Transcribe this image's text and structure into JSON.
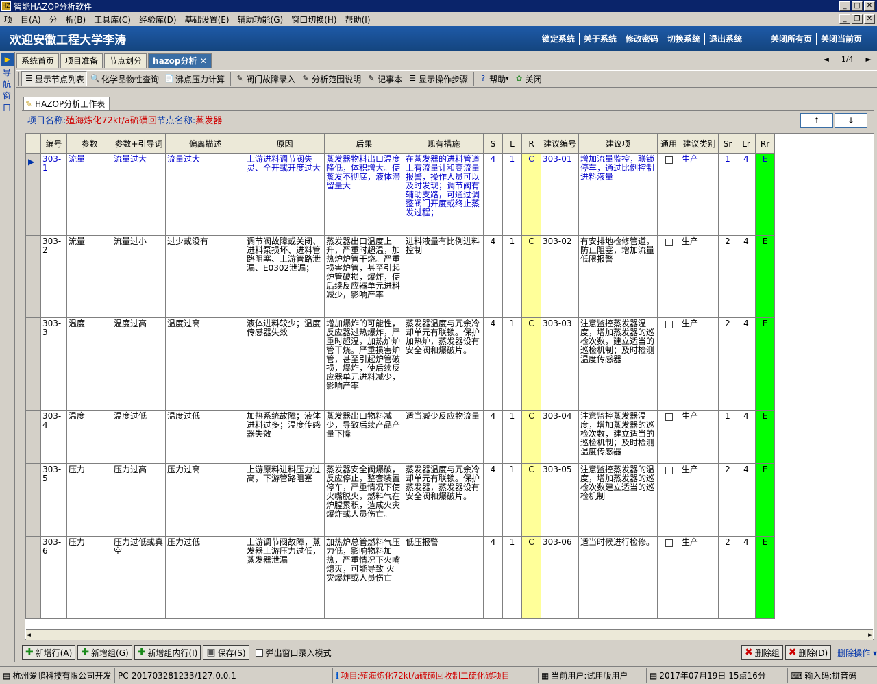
{
  "window": {
    "title": "智能HAZOP分析软件"
  },
  "menu": [
    "项",
    "目(A)",
    "分",
    "析(B)",
    "工具库(C)",
    "经验库(D)",
    "基础设置(E)",
    "辅助功能(G)",
    "窗口切换(H)",
    "帮助(I)"
  ],
  "banner": {
    "welcome": "欢迎安徽工程大学李涛",
    "links": [
      "锁定系统",
      "关于系统",
      "修改密码",
      "切换系统",
      "退出系统"
    ],
    "links2": [
      "关闭所有页",
      "关闭当前页"
    ]
  },
  "sidenav": {
    "text": "导航窗口"
  },
  "tabs": [
    "系统首页",
    "项目准备",
    "节点划分",
    "hazop分析"
  ],
  "pager": {
    "prev": "◄",
    "page": "1/4",
    "next": "►"
  },
  "toolbar": [
    "显示节点列表",
    "化学品物性查询",
    "沸点压力计算",
    "阀门故障录入",
    "分析范围说明",
    "记事本",
    "显示操作步骤",
    "帮助",
    "关闭"
  ],
  "worktab": "HAZOP分析工作表",
  "info": {
    "project_label": "项目名称:",
    "project_value": "殖海炼化72kt/a硫磺回",
    "node_label": "节点名称:",
    "node_value": "蒸发器"
  },
  "updown": {
    "up": "↑",
    "down": "↓"
  },
  "columns": [
    "编号",
    "参数",
    "参数+引导词",
    "偏离描述",
    "原因",
    "后果",
    "现有措施",
    "S",
    "L",
    "R",
    "建议编号",
    "建议项",
    "通用",
    "建议类别",
    "Sr",
    "Lr",
    "Rr"
  ],
  "rows": [
    {
      "id": "303-1",
      "param": "流量",
      "guide": "流量过大",
      "dev": "流量过大",
      "cause": "上游进料调节阀失灵、全开或开度过大",
      "conseq": "蒸发器物料出口温度降低，体积增大。使蒸发不彻底，液体滞留量大",
      "measure": "在蒸发器的进料管道上有流量计和高流量报警，操作人员可以及时发现；调节阀有辅助支路，可通过调整阀门开度或终止蒸发过程；",
      "s": "4",
      "l": "1",
      "r": "C",
      "sid": "303-01",
      "sug": "增加流量监控，联锁停车，通过比例控制进料液量",
      "cat": "生产",
      "sr": "1",
      "lr": "4",
      "rr": "E"
    },
    {
      "id": "303-2",
      "param": "流量",
      "guide": "流量过小",
      "dev": "过少或没有",
      "cause": "调节阀故障或关闭、进料泵损坏、进料管路阻塞、上游管路泄漏、E0302泄漏；",
      "conseq": "蒸发器出口温度上升，严重时超温，加热炉炉管干烧。严重损害炉管，甚至引起炉管破损，爆炸，使后续反应器单元进料减少，影响产率",
      "measure": "进料液量有比例进料控制",
      "s": "4",
      "l": "1",
      "r": "C",
      "sid": "303-02",
      "sug": "有安排地检修管道，防止阻塞，增加流量低限报警",
      "cat": "生产",
      "sr": "2",
      "lr": "4",
      "rr": "E"
    },
    {
      "id": "303-3",
      "param": "温度",
      "guide": "温度过高",
      "dev": "温度过高",
      "cause": "液体进料较少；温度传感器失效",
      "conseq": "增加爆炸的可能性，反应器过热爆炸，严重时超温，加热炉炉管干烧。严重损害炉管，甚至引起炉管破损，爆炸，使后续反应器单元进料减少，影响产率",
      "measure": "蒸发器温度与冗余冷却单元有联锁。保护加热炉，蒸发器设有安全阀和爆破片。",
      "s": "4",
      "l": "1",
      "r": "C",
      "sid": "303-03",
      "sug": "注意监控蒸发器温度，增加蒸发器的巡检次数，建立适当的巡检机制；及时检测温度传感器",
      "cat": "生产",
      "sr": "2",
      "lr": "4",
      "rr": "E"
    },
    {
      "id": "303-4",
      "param": "温度",
      "guide": "温度过低",
      "dev": "温度过低",
      "cause": "加热系统故障；液体进料过多；温度传感器失效",
      "conseq": "蒸发器出口物料减少，导致后续产品产量下降",
      "measure": "适当减少反应物流量",
      "s": "4",
      "l": "1",
      "r": "C",
      "sid": "303-04",
      "sug": "注意监控蒸发器温度，增加蒸发器的巡检次数，建立适当的巡检机制；及时检测温度传感器",
      "cat": "生产",
      "sr": "1",
      "lr": "4",
      "rr": "E"
    },
    {
      "id": "303-5",
      "param": "压力",
      "guide": "压力过高",
      "dev": "压力过高",
      "cause": "上游原料进料压力过高，下游管路阻塞",
      "conseq": "蒸发器安全阀爆破，反应停止，整套装置停车，严重情况下使火嘴脱火，燃料气在炉膛累积，造成火灾爆炸或人员伤亡。",
      "measure": "蒸发器温度与冗余冷却单元有联锁。保护蒸发器，蒸发器设有安全阀和爆破片。",
      "s": "4",
      "l": "1",
      "r": "C",
      "sid": "303-05",
      "sug": "注意监控蒸发器的温度，增加蒸发器的巡检次数建立适当的巡检机制",
      "cat": "生产",
      "sr": "2",
      "lr": "4",
      "rr": "E"
    },
    {
      "id": "303-6",
      "param": "压力",
      "guide": "压力过低或真空",
      "dev": "压力过低",
      "cause": "上游调节阀故障，蒸发器上游压力过低，蒸发器泄漏",
      "conseq": "加热炉总管燃料气压力低，影响物料加热，严重情况下火嘴熄灭，可能导致\n火灾爆炸或人员伤亡",
      "measure": "低压报警",
      "s": "4",
      "l": "1",
      "r": "C",
      "sid": "303-06",
      "sug": "适当时候进行检修。",
      "cat": "生产",
      "sr": "2",
      "lr": "4",
      "rr": "E"
    }
  ],
  "bottom": {
    "add_row": "新增行(A)",
    "add_group": "新增组(G)",
    "add_in_group": "新增组内行(I)",
    "save": "保存(S)",
    "popup": "弹出窗口录入模式",
    "del_group": "删除组",
    "del": "删除(D)",
    "batch": "删除操作"
  },
  "status": {
    "company": "杭州爱鹏科技有限公司开发",
    "pc": "PC-201703281233/127.0.0.1",
    "project": "项目:殖海炼化72kt/a硫磺回收制二硫化碳项目",
    "user": "当前用户:试用版用户",
    "datetime": "2017年07月19日 15点16分",
    "ime": "输入码:拼音码"
  },
  "colors": {
    "banner": "#1e5aa8",
    "title": "#0a246a",
    "r_col": "#ffff99",
    "rr_col": "#00ff00",
    "selected_text": "#0000cc"
  }
}
